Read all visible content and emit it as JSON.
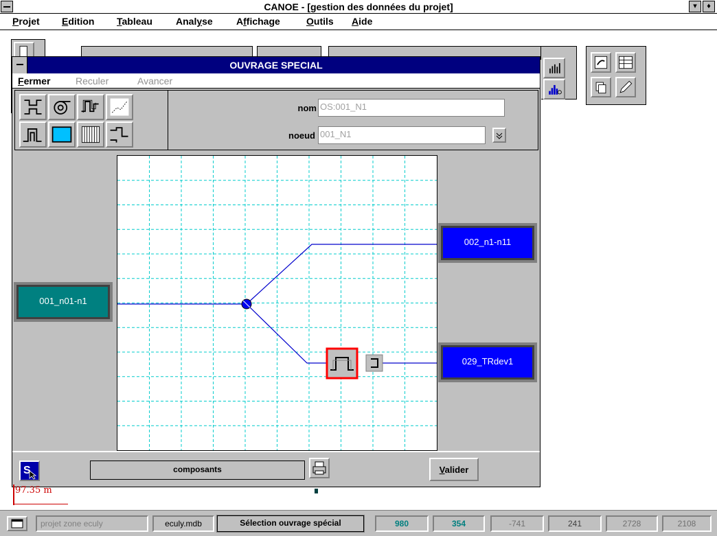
{
  "window": {
    "title": "CANOE - [gestion des données du projet]",
    "sys_right_1": "▾",
    "sys_right_2": "♦"
  },
  "menubar": [
    {
      "key": "P",
      "rest": "rojet"
    },
    {
      "key": "E",
      "rest": "dition"
    },
    {
      "key": "T",
      "rest": "ableau"
    },
    {
      "pre": "Anal",
      "key": "y",
      "rest": "se"
    },
    {
      "pre": "A",
      "key": "f",
      "rest": "fichage"
    },
    {
      "key": "O",
      "rest": "utils"
    },
    {
      "key": "A",
      "rest": "ide"
    }
  ],
  "dialog": {
    "title": "OUVRAGE SPECIAL",
    "menu": {
      "fermer": {
        "key": "F",
        "rest": "ermer"
      },
      "reculer": "Reculer",
      "avancer": "Avancer"
    },
    "nom_label": "nom",
    "nom_value": "OS:001_N1",
    "noeud_label": "noeud",
    "noeud_value": "001_N1",
    "nodes": {
      "left": "001_n01-n1",
      "right_top": "002_n1-n11",
      "right_bottom": "029_TRdev1"
    },
    "composants": "composants",
    "valider": {
      "key": "V",
      "rest": "alider"
    },
    "status_icon_letter": "S"
  },
  "scale": "97.35 m",
  "statusbar": {
    "project": "projet zone eculy",
    "db": "eculy.mdb",
    "mode": "Sélection ouvrage spécial",
    "v1": "980",
    "v2": "354",
    "v3": "-741",
    "v4": "241",
    "v5": "2728",
    "v6": "2108"
  },
  "colors": {
    "dialog_title": "#00007f",
    "node_teal": "#008080",
    "node_blue": "#0000ff",
    "grid_line": "#00cccc",
    "link_line": "#0000cc",
    "selected_border": "#ff0000",
    "status_value": "#007f7f"
  }
}
